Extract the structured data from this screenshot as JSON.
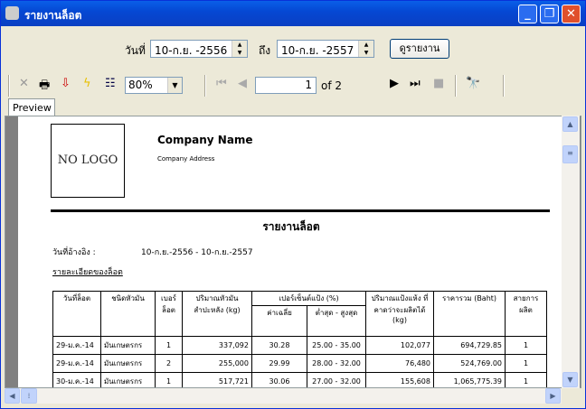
{
  "window": {
    "title": "รายงานล็อต"
  },
  "filter": {
    "from_label": "วันที่",
    "from_value": "10-ก.ย. -2556",
    "to_label": "ถึง",
    "to_value": "10-ก.ย. -2557",
    "view_button": "ดูรายงาน"
  },
  "toolbar": {
    "zoom": "80%",
    "page": "1",
    "of_pages": "of 2"
  },
  "tabs": {
    "preview": "Preview"
  },
  "report": {
    "logo": "NO LOGO",
    "company_name": "Company Name",
    "company_address": "Company Address",
    "title": "รายงานล็อต",
    "ref_label": "วันที่อ้างอิง :",
    "ref_value": "10-ก.ย.-2556 - 10-ก.ย.-2557",
    "section": "รายละเอียดของล็อต",
    "headers": {
      "date": "วันที่ล็อต",
      "type": "ชนิดหัวมัน",
      "lot": "เบอร์ ล็อต",
      "qty": "ปริมาณหัวมัน สำปะหลัง (kg)",
      "pct": "เปอร์เซ็นต์แป้ง (%)",
      "avg": "ค่าเฉลี่ย",
      "range": "ต่ำสุด - สูงสุด",
      "dry": "ปริมาณแป้งแห้ง ที่คาดว่าจะผลิตได้ (kg)",
      "price": "ราคารวม (Baht)",
      "line": "สายการ ผลิต"
    },
    "rows": [
      {
        "date": "29-ม.ค.-14",
        "type": "มันเกษตรกร",
        "lot": "1",
        "qty": "337,092",
        "avg": "30.28",
        "range": "25.00 - 35.00",
        "dry": "102,077",
        "price": "694,729.85",
        "line": "1"
      },
      {
        "date": "29-ม.ค.-14",
        "type": "มันเกษตรกร",
        "lot": "2",
        "qty": "255,000",
        "avg": "29.99",
        "range": "28.00 - 32.00",
        "dry": "76,480",
        "price": "524,769.00",
        "line": "1"
      },
      {
        "date": "30-ม.ค.-14",
        "type": "มันเกษตรกร",
        "lot": "1",
        "qty": "517,721",
        "avg": "30.06",
        "range": "27.00 - 32.00",
        "dry": "155,608",
        "price": "1,065,775.39",
        "line": "1"
      }
    ]
  }
}
